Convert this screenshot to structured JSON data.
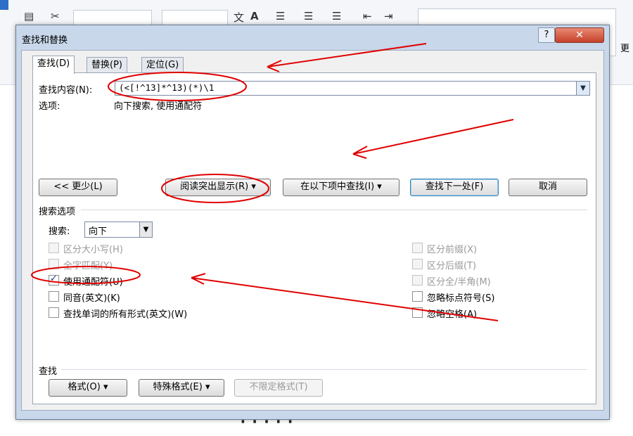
{
  "ribbon": {
    "more_label": "更"
  },
  "dialog": {
    "title": "查找和替换",
    "help_label": "?",
    "close_label": "✕",
    "tabs": [
      {
        "label": "查找(D)",
        "active": true
      },
      {
        "label": "替换(P)",
        "active": false
      },
      {
        "label": "定位(G)",
        "active": false
      }
    ],
    "find": {
      "label": "查找内容(N):",
      "value": "(<[!^13]*^13)(*)\\1",
      "options_label": "选项:",
      "options_value": "向下搜索, 使用通配符"
    },
    "buttons": {
      "less": "<< 更少(L)",
      "reading_highlight": "阅读突出显示(R) ▾",
      "find_in": "在以下项中查找(I) ▾",
      "find_next": "查找下一处(F)",
      "cancel": "取消"
    },
    "search_options": {
      "heading": "搜索选项",
      "search_label": "搜索:",
      "search_value": "向下",
      "left": [
        {
          "label": "区分大小写(H)",
          "checked": false,
          "enabled": false
        },
        {
          "label": "全字匹配(Y)",
          "checked": false,
          "enabled": false
        },
        {
          "label": "使用通配符(U)",
          "checked": true,
          "enabled": true
        },
        {
          "label": "同音(英文)(K)",
          "checked": false,
          "enabled": true
        },
        {
          "label": "查找单词的所有形式(英文)(W)",
          "checked": false,
          "enabled": true
        }
      ],
      "right": [
        {
          "label": "区分前缀(X)",
          "checked": false,
          "enabled": false
        },
        {
          "label": "区分后缀(T)",
          "checked": false,
          "enabled": false
        },
        {
          "label": "区分全/半角(M)",
          "checked": false,
          "enabled": false
        },
        {
          "label": "忽略标点符号(S)",
          "checked": false,
          "enabled": true
        },
        {
          "label": "忽略空格(A)",
          "checked": false,
          "enabled": true
        }
      ]
    },
    "find_section": {
      "heading": "查找",
      "format_button": "格式(O) ▾",
      "special_button": "特殊格式(E) ▾",
      "no_format_button": "不限定格式(T)"
    }
  },
  "annotation_color": "#e00000"
}
